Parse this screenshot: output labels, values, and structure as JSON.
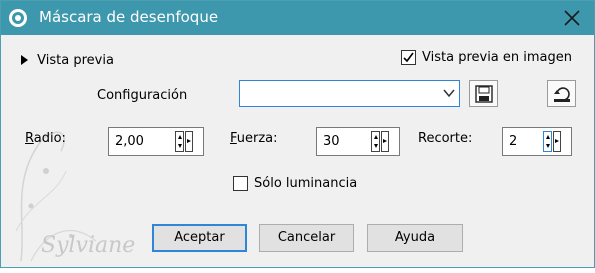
{
  "window": {
    "title": "Máscara de desenfoque",
    "close_icon": "close-icon",
    "app_icon": "blur-mask-app-icon"
  },
  "preview": {
    "toggle_label": "Vista previa",
    "image_preview_label": "Vista previa en imagen",
    "image_preview_checked": true
  },
  "settings": {
    "label": "Configuración",
    "value": "",
    "save_icon": "save-icon",
    "reset_icon": "reset-icon"
  },
  "params": {
    "radio": {
      "label": "Radio:",
      "value": "2,00"
    },
    "fuerza": {
      "label": "Fuerza:",
      "value": "30"
    },
    "recorte": {
      "label": "Recorte:",
      "value": "2"
    }
  },
  "options": {
    "luminance_label": "Sólo luminancia",
    "luminance_checked": false
  },
  "buttons": {
    "accept": "Aceptar",
    "cancel": "Cancelar",
    "help": "Ayuda"
  },
  "watermark": {
    "text": "Sylviane"
  },
  "colors": {
    "titlebar": "#3d98ad",
    "focus_blue": "#2f86d8",
    "background": "#f0f0f0"
  }
}
